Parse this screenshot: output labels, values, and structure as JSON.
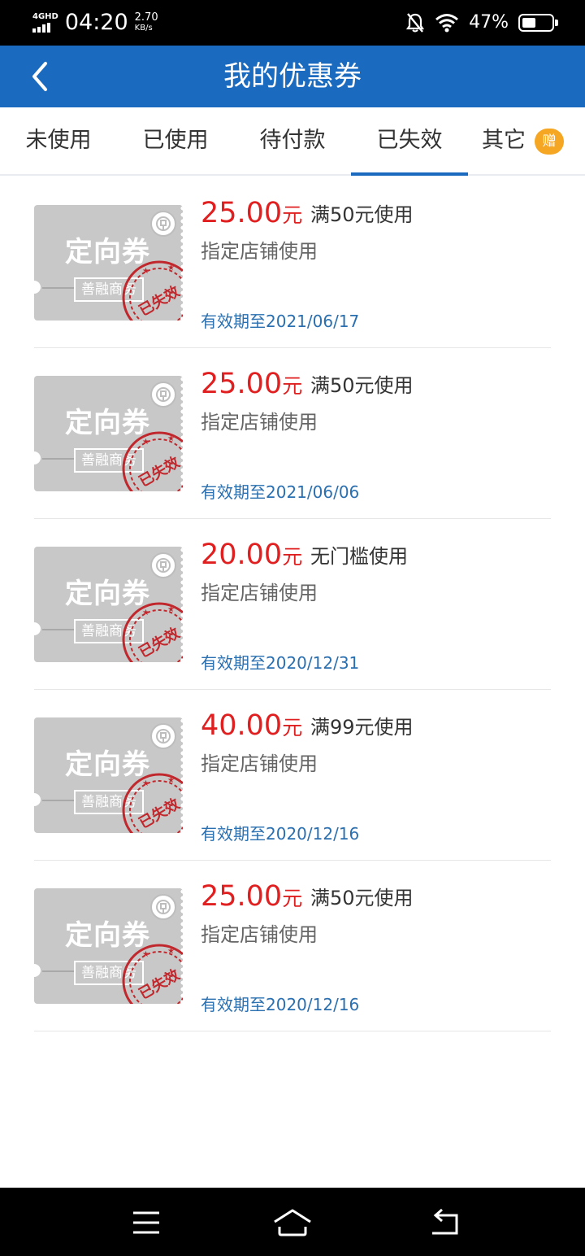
{
  "status_bar": {
    "network": "4GHD",
    "time": "04:20",
    "speed_value": "2.70",
    "speed_unit": "KB/s",
    "battery": "47%",
    "battery_level": 0.47
  },
  "header": {
    "title": "我的优惠券"
  },
  "tabs": [
    {
      "label": "未使用",
      "active": false
    },
    {
      "label": "已使用",
      "active": false
    },
    {
      "label": "待付款",
      "active": false
    },
    {
      "label": "已失效",
      "active": true
    },
    {
      "label": "其它",
      "active": false
    }
  ],
  "gift_badge": "赠",
  "coupons": [
    {
      "ticket_title": "定向券",
      "brand": "善融商务",
      "stamp": "已失效",
      "amount": "25.00",
      "unit": "元",
      "condition": "满50元使用",
      "scope": "指定店铺使用",
      "expiry": "有效期至2021/06/17"
    },
    {
      "ticket_title": "定向券",
      "brand": "善融商务",
      "stamp": "已失效",
      "amount": "25.00",
      "unit": "元",
      "condition": "满50元使用",
      "scope": "指定店铺使用",
      "expiry": "有效期至2021/06/06"
    },
    {
      "ticket_title": "定向券",
      "brand": "善融商务",
      "stamp": "已失效",
      "amount": "20.00",
      "unit": "元",
      "condition": "无门槛使用",
      "scope": "指定店铺使用",
      "expiry": "有效期至2020/12/31"
    },
    {
      "ticket_title": "定向券",
      "brand": "善融商务",
      "stamp": "已失效",
      "amount": "40.00",
      "unit": "元",
      "condition": "满99元使用",
      "scope": "指定店铺使用",
      "expiry": "有效期至2020/12/16"
    },
    {
      "ticket_title": "定向券",
      "brand": "善融商务",
      "stamp": "已失效",
      "amount": "25.00",
      "unit": "元",
      "condition": "满50元使用",
      "scope": "指定店铺使用",
      "expiry": "有效期至2020/12/16"
    }
  ],
  "colors": {
    "header_bg": "#1a6bbf",
    "amount": "#e02020",
    "expiry": "#2a6fb0",
    "stamp": "#c0282d",
    "badge": "#f5a623"
  }
}
